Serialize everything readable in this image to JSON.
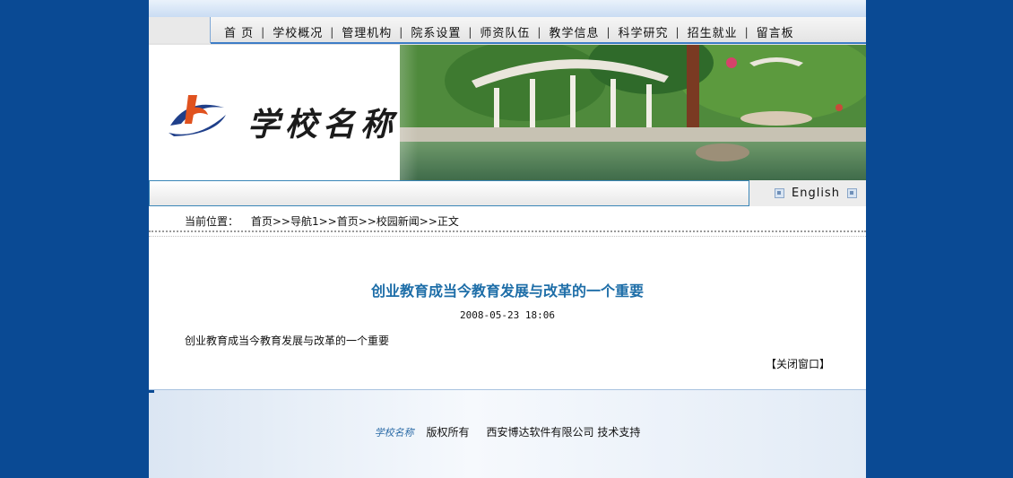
{
  "nav": {
    "items": [
      "首 页",
      "学校概况",
      "管理机构",
      "院系设置",
      "师资队伍",
      "教学信息",
      "科学研究",
      "招生就业",
      "留言板"
    ]
  },
  "banner": {
    "school_name": "学校名称"
  },
  "lang": {
    "english": "English"
  },
  "breadcrumb": {
    "label": "当前位置：",
    "path": "首页>>导航1>>首页>>校园新闻>>正文"
  },
  "article": {
    "title": "创业教育成当今教育发展与改革的一个重要",
    "date": "2008-05-23 18:06",
    "body": "创业教育成当今教育发展与改革的一个重要",
    "close_label": "【关闭窗口】"
  },
  "footer": {
    "school": "学校名称",
    "copyright": "版权所有",
    "company": "西安博达软件有限公司",
    "support": "技术支持"
  },
  "colors": {
    "page_bg": "#0a4a94",
    "title": "#1e6ea8",
    "nav_line": "#3d7dc6"
  }
}
